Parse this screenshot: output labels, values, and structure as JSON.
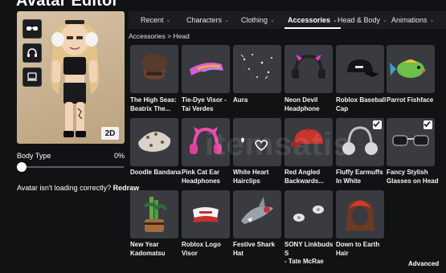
{
  "app": {
    "title": "Avatar Editor"
  },
  "preview": {
    "view_mode_label": "2D",
    "side_buttons": [
      {
        "icon": "sunglasses-icon"
      },
      {
        "icon": "headphones-icon"
      },
      {
        "icon": "monitor-icon"
      }
    ]
  },
  "body_type": {
    "label": "Body Type",
    "value_text": "0%",
    "value": 0
  },
  "help": {
    "question": "Avatar isn't loading correctly?",
    "action": "Redraw"
  },
  "tabs": [
    {
      "label": "Recent",
      "active": false
    },
    {
      "label": "Characters",
      "active": false
    },
    {
      "label": "Clothing",
      "active": false
    },
    {
      "label": "Accessories",
      "active": true
    },
    {
      "label": "Head & Body",
      "active": false
    },
    {
      "label": "Animations",
      "active": false
    }
  ],
  "breadcrumb": {
    "parent": "Accessories",
    "separator": ">",
    "current": "Head"
  },
  "items": [
    {
      "name_lines": [
        "The High Seas:",
        "Beatrix The..."
      ],
      "checked": false
    },
    {
      "name_lines": [
        "Tie-Dye Visor -",
        "Tai Verdes"
      ],
      "checked": false
    },
    {
      "name_lines": [
        "Aura"
      ],
      "checked": false
    },
    {
      "name_lines": [
        "Neon Devil",
        "Headphone"
      ],
      "checked": false
    },
    {
      "name_lines": [
        "Roblox Baseball",
        "Cap"
      ],
      "checked": false
    },
    {
      "name_lines": [
        "Parrot Fishface"
      ],
      "checked": false
    },
    {
      "name_lines": [
        "Doodle Bandana"
      ],
      "checked": false
    },
    {
      "name_lines": [
        "Pink Cat Ear",
        "Headphones"
      ],
      "checked": false
    },
    {
      "name_lines": [
        "White Heart",
        "Hairclips"
      ],
      "checked": false
    },
    {
      "name_lines": [
        "Red Angled",
        "Backwards..."
      ],
      "checked": false
    },
    {
      "name_lines": [
        "Fluffy Earmuffs",
        "In White"
      ],
      "checked": true
    },
    {
      "name_lines": [
        "Fancy Stylish",
        "Glasses on Head"
      ],
      "checked": true
    },
    {
      "name_lines": [
        "New Year",
        "Kadomatsu"
      ],
      "checked": false
    },
    {
      "name_lines": [
        "Roblox Logo",
        "Visor"
      ],
      "checked": false
    },
    {
      "name_lines": [
        "Festive Shark",
        "Hat"
      ],
      "checked": false
    },
    {
      "name_lines": [
        "SONY Linkbuds S",
        "- Tate McRae"
      ],
      "checked": false
    },
    {
      "name_lines": [
        "Down to Earth",
        "Hair"
      ],
      "checked": false
    }
  ],
  "footer": {
    "advanced_label": "Advanced"
  },
  "watermark": {
    "text": "itemsatis"
  },
  "colors": {
    "background": "#111214",
    "tile": "#3a3b40",
    "tabbar": "#1c1d21",
    "preview_bg": "#c9b08f"
  }
}
